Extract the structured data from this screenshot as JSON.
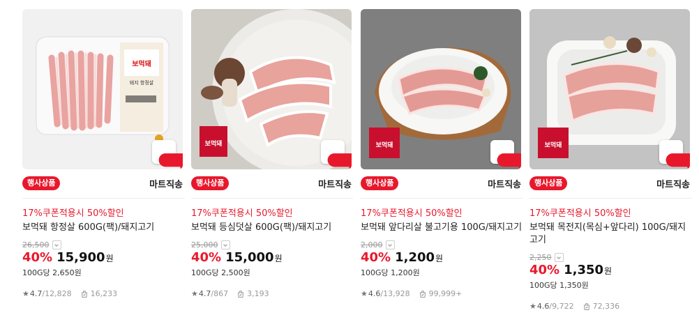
{
  "products": [
    {
      "event_badge": "행사상품",
      "shipping": "마트직송",
      "coupon": "17%쿠폰적용시 50%할인",
      "name": "보먹돼 항정살 600G(팩)/돼지고기",
      "original_price": "26,500",
      "discount": "40%",
      "price": "15,900",
      "currency": "원",
      "unit_price": "100G당 2,650원",
      "rating": "4.7",
      "review_count": "/12,828",
      "purchase_count": "16,233",
      "label_text": "돼지 항정살",
      "brand": "보먹돼"
    },
    {
      "event_badge": "행사상품",
      "shipping": "마트직송",
      "coupon": "17%쿠폰적용시 50%할인",
      "name": "보먹돼 등심덧살 600G(팩)/돼지고기",
      "original_price": "25,000",
      "discount": "40%",
      "price": "15,000",
      "currency": "원",
      "unit_price": "100G당 2,500원",
      "rating": "4.7",
      "review_count": "/867",
      "purchase_count": "3,193",
      "brand": "보먹돼"
    },
    {
      "event_badge": "행사상품",
      "shipping": "마트직송",
      "coupon": "17%쿠폰적용시 50%할인",
      "name": "보먹돼 앞다리살 불고기용 100G/돼지고기",
      "original_price": "2,000",
      "discount": "40%",
      "price": "1,200",
      "currency": "원",
      "unit_price": "100G당 1,200원",
      "rating": "4.6",
      "review_count": "/13,928",
      "purchase_count": "99,999+",
      "brand": "보먹돼"
    },
    {
      "event_badge": "행사상품",
      "shipping": "마트직송",
      "coupon": "17%쿠폰적용시 50%할인",
      "name": "보먹돼 목전지(목심+앞다리) 100G/돼지고기",
      "original_price": "2,250",
      "discount": "40%",
      "price": "1,350",
      "currency": "원",
      "unit_price": "100G당 1,350원",
      "rating": "4.6",
      "review_count": "/9,722",
      "purchase_count": "72,336",
      "brand": "보먹돼"
    }
  ],
  "colors": {
    "accent": "#e8182c",
    "muted": "#999999"
  },
  "icons": {
    "cart": "cart-icon",
    "star": "star-icon",
    "purchases": "bag-check-icon",
    "expand": "chevron-down-icon"
  }
}
